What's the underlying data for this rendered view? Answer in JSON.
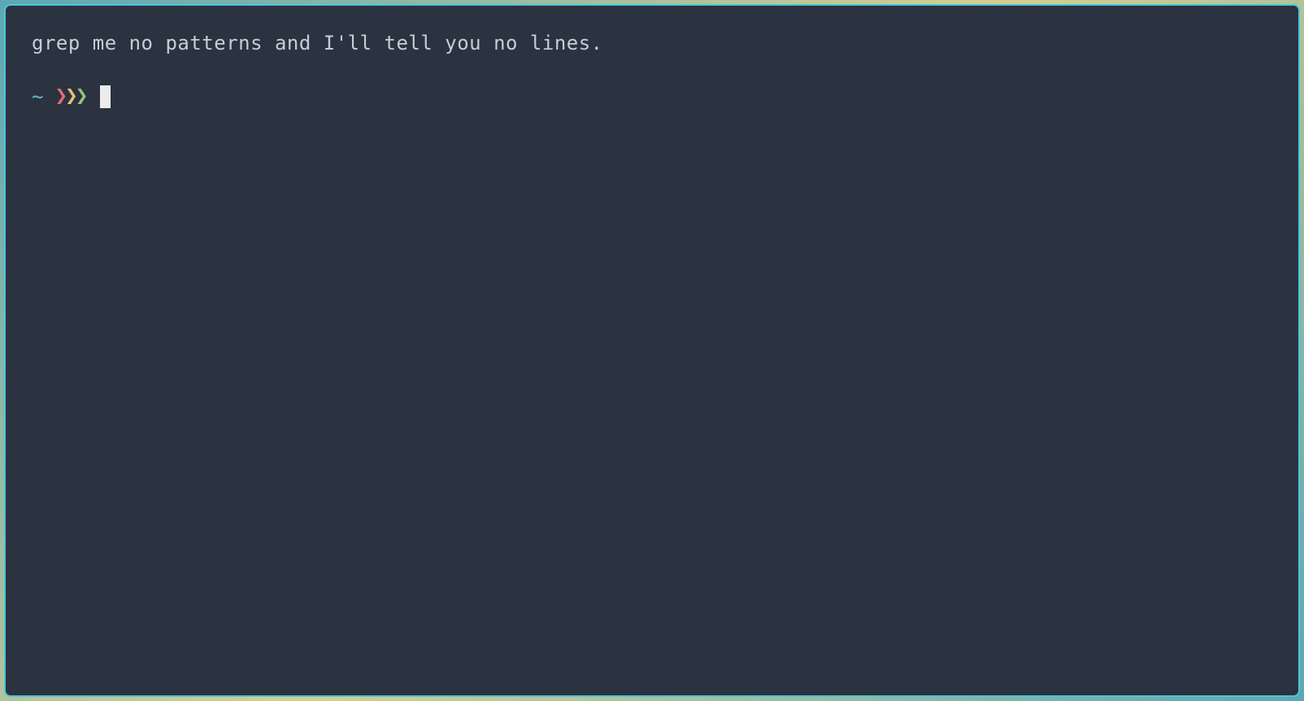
{
  "terminal": {
    "motd": "grep me no patterns and I'll tell you no lines.",
    "prompt": {
      "cwd": "~",
      "chevron1": "❯",
      "chevron2": "❯",
      "chevron3": "❯",
      "input": ""
    },
    "colors": {
      "background": "#2b3240",
      "border": "#4fc3d9",
      "text": "#c7cdd8",
      "cwd": "#6fb8c8",
      "chevron_red": "#e06c75",
      "chevron_yellow": "#e5c07b",
      "chevron_green": "#98c379",
      "cursor": "#ebebec"
    }
  }
}
